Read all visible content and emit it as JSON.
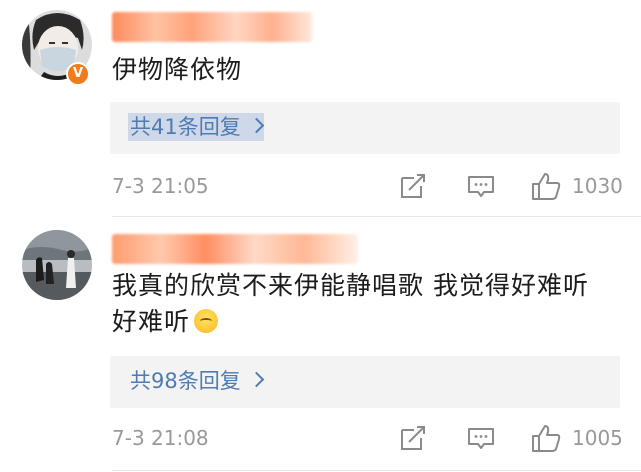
{
  "comments": [
    {
      "text": "伊物降依物",
      "replies_label": "共41条回复",
      "time": "7-3 21:05",
      "likes": "1030",
      "verified_badge": "V"
    },
    {
      "text_line1": "我真的欣赏不来伊能静唱歌 我觉得好难听",
      "text_line2": "好难听",
      "replies_label": "共98条回复",
      "time": "7-3 21:08",
      "likes": "1005"
    }
  ],
  "icons": [
    "share-edit-icon",
    "comment-icon",
    "thumbs-up-icon",
    "chevron-right-icon"
  ],
  "colors": {
    "link": "#4f7bb0",
    "meta": "#999999",
    "badge": "#f07c1b",
    "reply_bg": "#f3f3f3"
  }
}
